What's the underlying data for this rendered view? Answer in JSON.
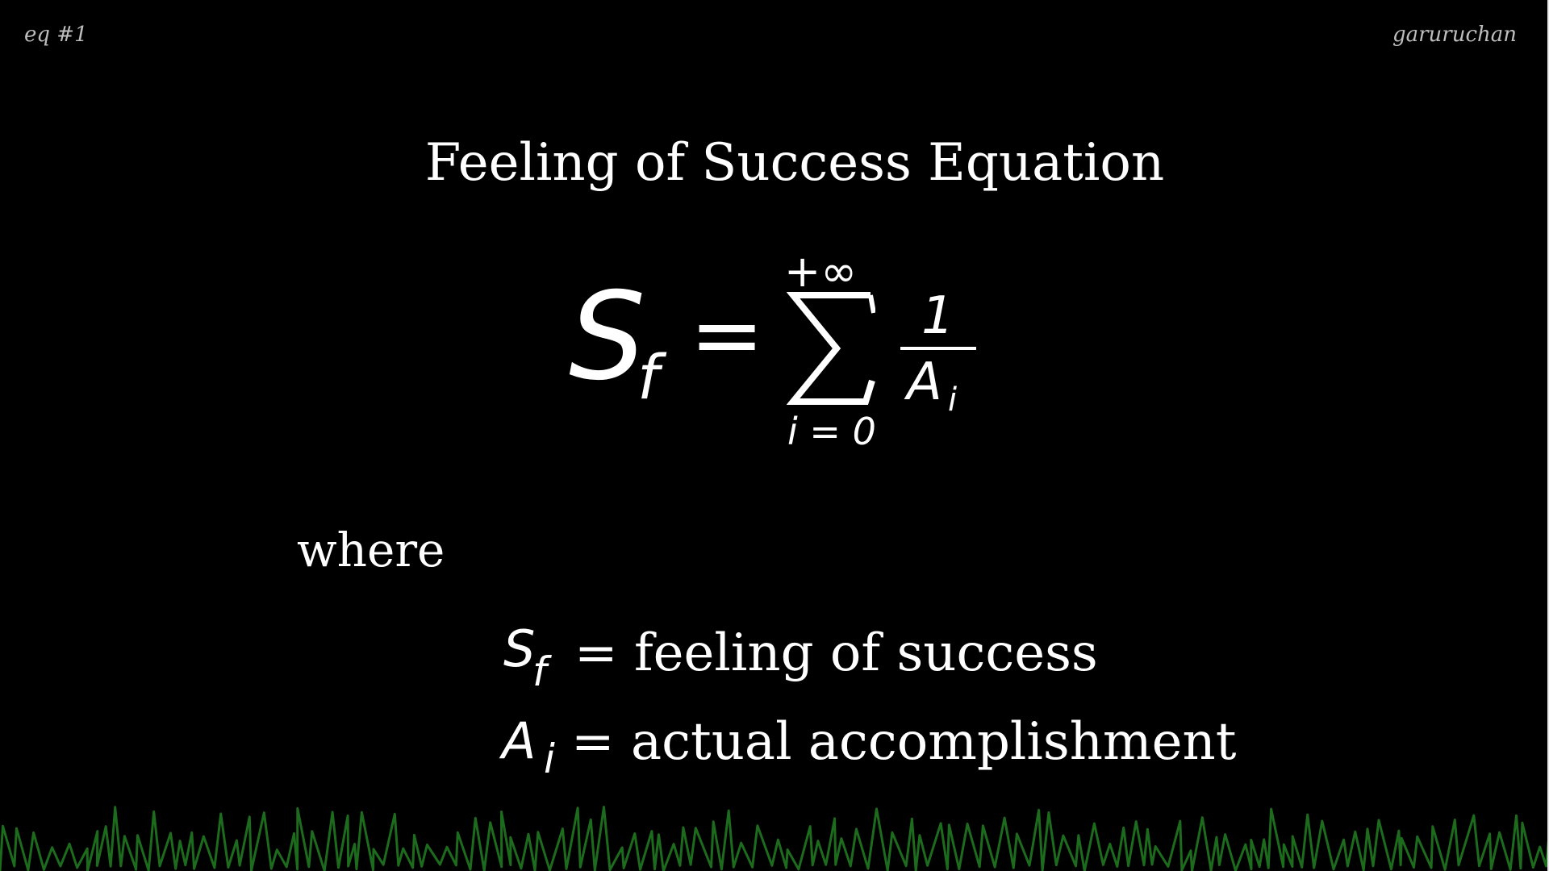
{
  "header": {
    "left_label": "eq #1",
    "right_label": "garuruchan"
  },
  "title": "Feeling of Success Equation",
  "equation": {
    "lhs_symbol": "S",
    "lhs_subscript": "f",
    "equals": "=",
    "sum_symbol": "∑",
    "sum_upper": "+∞",
    "sum_lower": "i = 0",
    "numerator": "1",
    "denominator_symbol": "A",
    "denominator_subscript": "i"
  },
  "where_label": "where",
  "definitions": [
    {
      "symbol": "S",
      "subscript": "f",
      "text": "= feeling of success"
    },
    {
      "symbol": "A",
      "subscript": "i",
      "text": "= actual accomplishment"
    }
  ],
  "colors": {
    "background": "#000000",
    "text": "#ffffff",
    "corner_text": "#bdbdbd",
    "grass": "#1d6b1d"
  }
}
